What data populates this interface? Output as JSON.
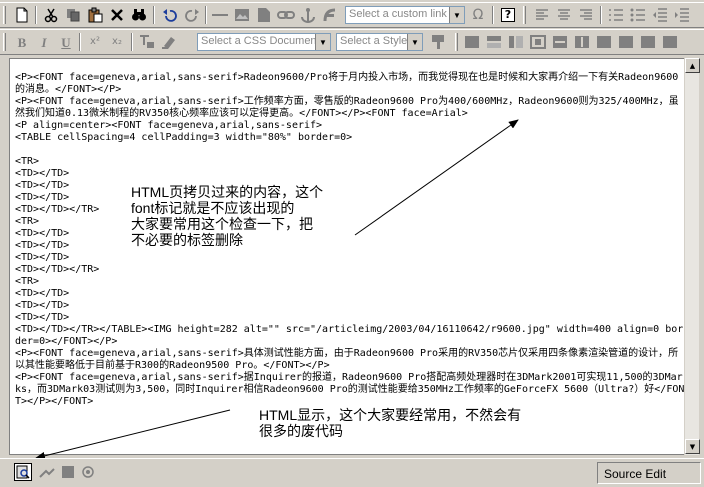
{
  "toolbar1": {
    "link_combo_placeholder": "Select a custom link",
    "omega_symbol": "Ω",
    "help_symbol": "?"
  },
  "toolbar2": {
    "bold": "B",
    "italic": "I",
    "underline": "U",
    "superscript": "x²",
    "subscript": "x₂",
    "css_combo_placeholder": "Select a CSS Document",
    "style_combo_placeholder": "Select a Style"
  },
  "editor": {
    "source_code": "<P><FONT face=geneva,arial,sans-serif>Radeon9600/Pro将于月内投入市场，而我觉得现在也是时候和大家再介绍一下有关Radeon9600的消息。</FONT></P>\n<P><FONT face=geneva,arial,sans-serif>工作频率方面，零售版的Radeon9600 Pro为400/600MHz，Radeon9600则为325/400MHz，虽然我们知道0.13微米制程的RV350核心频率应该可以定得更高。</FONT></P><FONT face=Arial>\n<P align=center><FONT face=geneva,arial,sans-serif>\n<TABLE cellSpacing=4 cellPadding=3 width=\"80%\" border=0>\n\n<TR>\n<TD></TD>\n<TD></TD>\n<TD></TD>\n<TD></TD></TR>\n<TR>\n<TD></TD>\n<TD></TD>\n<TD></TD>\n<TD></TD></TR>\n<TR>\n<TD></TD>\n<TD></TD>\n<TD></TD>\n<TD></TD></TR></TABLE><IMG height=282 alt=\"\" src=\"/articleimg/2003/04/16110642/r9600.jpg\" width=400 align=0 border=0></FONT></P>\n<P><FONT face=geneva,arial,sans-serif>具体测试性能方面，由于Radeon9600 Pro采用的RV350芯片仅采用四条像素渲染管道的设计，所以其性能要略低于目前基于R300的Radeon9500 Pro。</FONT></P>\n<P><FONT face=geneva,arial,sans-serif>据Inquirer的报道，Radeon9600 Pro搭配高频处理器时在3DMark2001可实现11,500的3DMarks，而3DMark03测试则为3,500，同时Inquirer相信Radeon9600 Pro的测试性能要给350MHz工作频率的GeForceFX 5600（Ultra?）好</FONT></P></FONT>"
  },
  "annotations": {
    "note1": "HTML页拷贝过来的内容，这个\nfont标记就是不应该出现的\n大家要常用这个检查一下，把\n不必要的标签删除",
    "note2": "HTML显示，这个大家要经常用，不然会有\n很多的废代码"
  },
  "statusbar": {
    "mode_label": "Source Edit"
  }
}
